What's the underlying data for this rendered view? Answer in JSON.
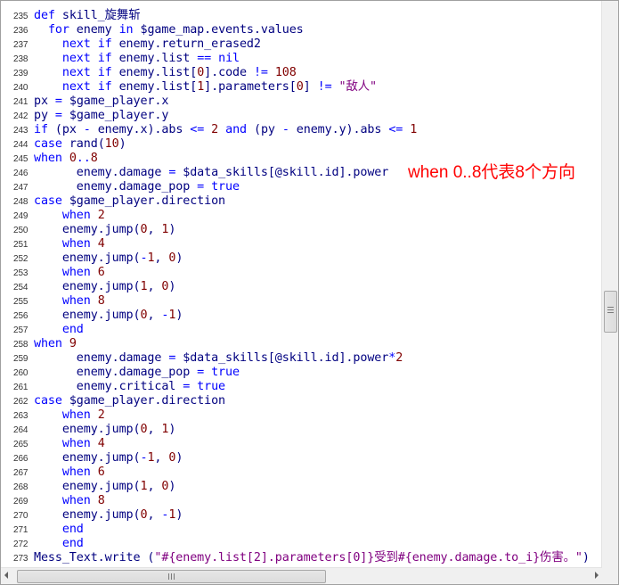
{
  "editor": {
    "lines": [
      {
        "n": "235",
        "c": "def skill_旋舞斩"
      },
      {
        "n": "236",
        "c": "  for enemy in $game_map.events.values"
      },
      {
        "n": "237",
        "c": "    next if enemy.return_erased2"
      },
      {
        "n": "238",
        "c": "    next if enemy.list == nil"
      },
      {
        "n": "239",
        "c": "    next if enemy.list[0].code != 108"
      },
      {
        "n": "240",
        "c": "    next if enemy.list[1].parameters[0] != \"敌人\""
      },
      {
        "n": "241",
        "c": "px = $game_player.x"
      },
      {
        "n": "242",
        "c": "py = $game_player.y"
      },
      {
        "n": "243",
        "c": "if (px - enemy.x).abs <= 2 and (py - enemy.y).abs <= 1"
      },
      {
        "n": "244",
        "c": "case rand(10)"
      },
      {
        "n": "245",
        "c": "when 0..8"
      },
      {
        "n": "246",
        "c": "      enemy.damage = $data_skills[@skill.id].power"
      },
      {
        "n": "247",
        "c": "      enemy.damage_pop = true"
      },
      {
        "n": "248",
        "c": "case $game_player.direction"
      },
      {
        "n": "249",
        "c": "    when 2"
      },
      {
        "n": "250",
        "c": "    enemy.jump(0, 1)"
      },
      {
        "n": "251",
        "c": "    when 4"
      },
      {
        "n": "252",
        "c": "    enemy.jump(-1, 0)"
      },
      {
        "n": "253",
        "c": "    when 6"
      },
      {
        "n": "254",
        "c": "    enemy.jump(1, 0)"
      },
      {
        "n": "255",
        "c": "    when 8"
      },
      {
        "n": "256",
        "c": "    enemy.jump(0, -1)"
      },
      {
        "n": "257",
        "c": "    end"
      },
      {
        "n": "258",
        "c": "when 9"
      },
      {
        "n": "259",
        "c": "      enemy.damage = $data_skills[@skill.id].power*2"
      },
      {
        "n": "260",
        "c": "      enemy.damage_pop = true"
      },
      {
        "n": "261",
        "c": "      enemy.critical = true"
      },
      {
        "n": "262",
        "c": "case $game_player.direction"
      },
      {
        "n": "263",
        "c": "    when 2"
      },
      {
        "n": "264",
        "c": "    enemy.jump(0, 1)"
      },
      {
        "n": "265",
        "c": "    when 4"
      },
      {
        "n": "266",
        "c": "    enemy.jump(-1, 0)"
      },
      {
        "n": "267",
        "c": "    when 6"
      },
      {
        "n": "268",
        "c": "    enemy.jump(1, 0)"
      },
      {
        "n": "269",
        "c": "    when 8"
      },
      {
        "n": "270",
        "c": "    enemy.jump(0, -1)"
      },
      {
        "n": "271",
        "c": "    end"
      },
      {
        "n": "272",
        "c": "    end"
      },
      {
        "n": "273",
        "c": "Mess_Text.write (\"#{enemy.list[2].parameters[0]}受到#{enemy.damage.to_i}伤害。\")"
      }
    ]
  },
  "annotation": {
    "text": "when 0..8代表8个方向",
    "color": "#ff0000"
  },
  "colors": {
    "keyword": "#0000ff",
    "identifier": "#000080",
    "number": "#800000",
    "string": "#800080"
  }
}
